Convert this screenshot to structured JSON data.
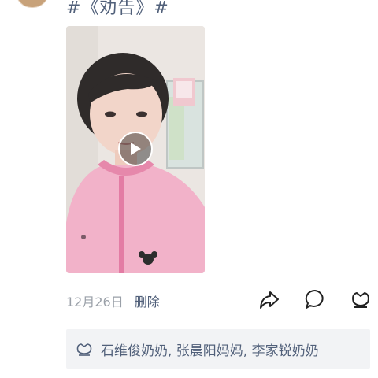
{
  "post": {
    "text": "#《劝告》#",
    "date": "12月26日",
    "delete_label": "删除"
  },
  "video": {
    "play_icon": "play-icon"
  },
  "actions": {
    "share_icon": "share-icon",
    "comment_icon": "comment-icon",
    "like_icon": "like-icon"
  },
  "likes": {
    "icon": "heart-outline-icon",
    "names": "石维俊奶奶, 张晨阳妈妈, 李家锐奶奶"
  },
  "colors": {
    "link": "#51607a",
    "meta": "#9aa0a8",
    "likes_bg": "#f2f3f5"
  }
}
